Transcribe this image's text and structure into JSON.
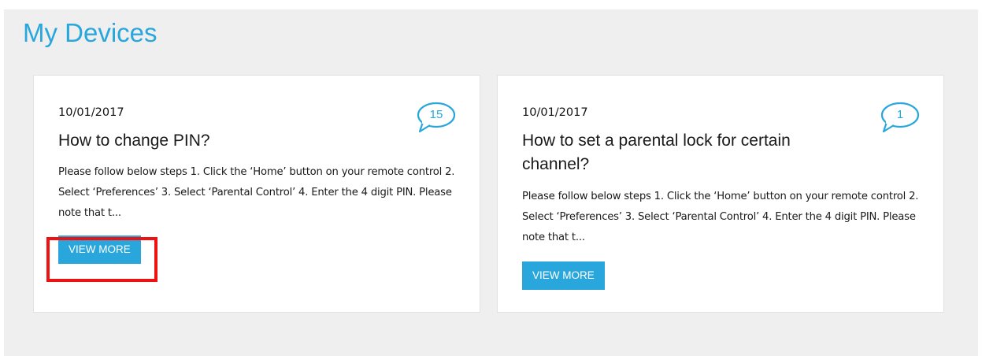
{
  "section": {
    "title": "My Devices"
  },
  "colors": {
    "accent": "#29a6dc",
    "highlight": "#ee1111",
    "panel_background": "#efefef"
  },
  "cards": [
    {
      "date": "10/01/2017",
      "title": "How to change PIN?",
      "description": "Please follow below steps 1. Click the ‘Home’ button on your remote control 2. Select ‘Preferences’ 3. Select ‘Parental Control’ 4. Enter the 4 digit PIN. Please note that t...",
      "comment_count": "15",
      "button_label": "VIEW MORE",
      "icon": "speech-bubble-icon"
    },
    {
      "date": "10/01/2017",
      "title": "How to set a parental lock for certain channel?",
      "description": "Please follow below steps 1. Click the ‘Home’ button on your remote control 2. Select ‘Preferences’ 3. Select ‘Parental Control’ 4. Enter the 4 digit PIN. Please note that t...",
      "comment_count": "1",
      "button_label": "VIEW MORE",
      "icon": "speech-bubble-icon"
    }
  ]
}
